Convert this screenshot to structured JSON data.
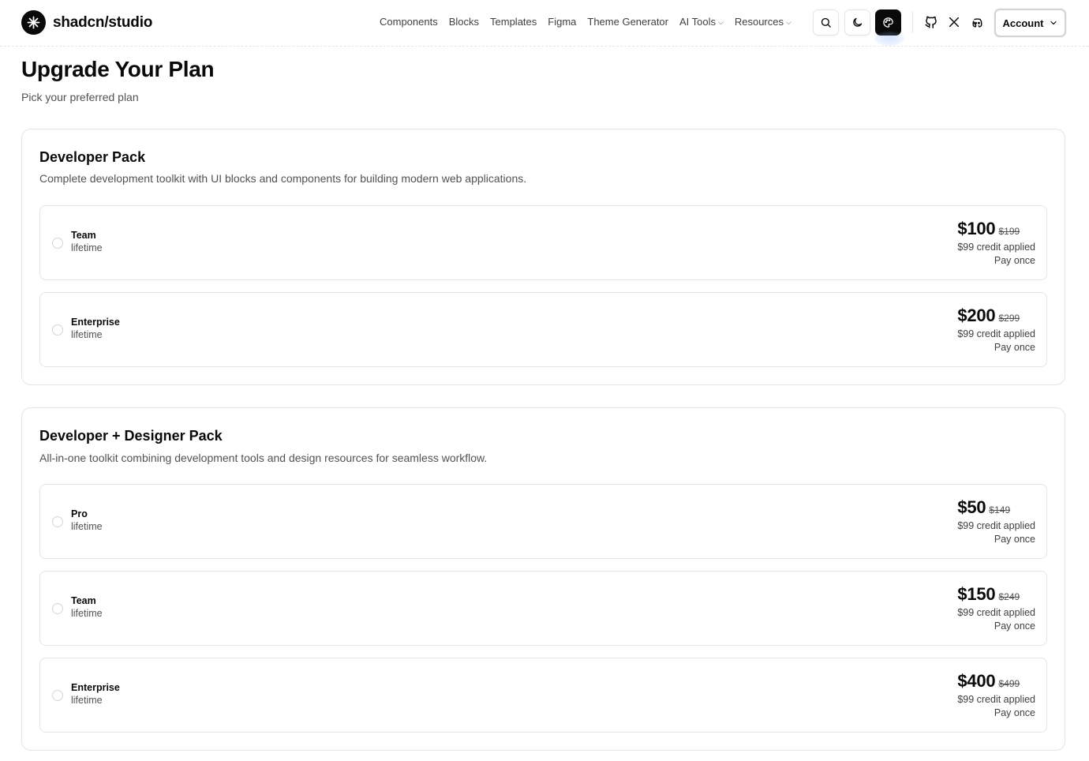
{
  "header": {
    "brand": "shadcn/studio",
    "nav": [
      {
        "label": "Components",
        "dropdown": false
      },
      {
        "label": "Blocks",
        "dropdown": false
      },
      {
        "label": "Templates",
        "dropdown": false
      },
      {
        "label": "Figma",
        "dropdown": false
      },
      {
        "label": "Theme Generator",
        "dropdown": false
      },
      {
        "label": "AI Tools",
        "dropdown": true
      },
      {
        "label": "Resources",
        "dropdown": true
      }
    ],
    "icons": [
      "search-icon",
      "moon-icon",
      "palette-icon",
      "github-icon",
      "x-icon",
      "discord-icon"
    ],
    "account_label": "Account"
  },
  "page": {
    "title": "Upgrade Your Plan",
    "subtitle": "Pick your preferred plan"
  },
  "packs": [
    {
      "title": "Developer Pack",
      "description": "Complete development toolkit with UI blocks and components for building modern web applications.",
      "options": [
        {
          "name": "Team",
          "term": "lifetime",
          "price": "$100",
          "original": "$199",
          "credit": "$99 credit applied",
          "note": "Pay once"
        },
        {
          "name": "Enterprise",
          "term": "lifetime",
          "price": "$200",
          "original": "$299",
          "credit": "$99 credit applied",
          "note": "Pay once"
        }
      ]
    },
    {
      "title": "Developer + Designer Pack",
      "description": "All-in-one toolkit combining development tools and design resources for seamless workflow.",
      "options": [
        {
          "name": "Pro",
          "term": "lifetime",
          "price": "$50",
          "original": "$149",
          "credit": "$99 credit applied",
          "note": "Pay once"
        },
        {
          "name": "Team",
          "term": "lifetime",
          "price": "$150",
          "original": "$249",
          "credit": "$99 credit applied",
          "note": "Pay once"
        },
        {
          "name": "Enterprise",
          "term": "lifetime",
          "price": "$400",
          "original": "$499",
          "credit": "$99 credit applied",
          "note": "Pay once"
        }
      ]
    }
  ],
  "colors": {
    "text": "#0a0a0a",
    "muted": "#525252",
    "border": "#e5e5e5"
  }
}
